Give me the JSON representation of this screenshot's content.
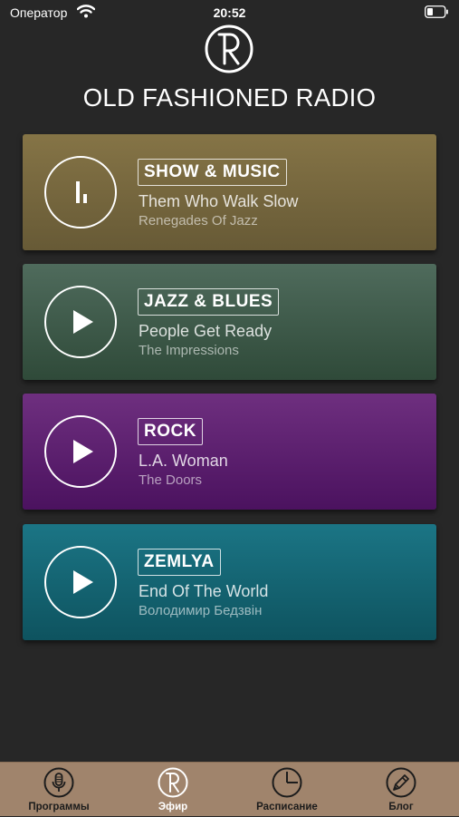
{
  "status_bar": {
    "carrier": "Оператор",
    "time": "20:52"
  },
  "header": {
    "title": "OLD FASHIONED RADIO"
  },
  "stations": [
    {
      "genre": "SHOW & MUSIC",
      "song": "Them Who Walk Slow",
      "artist": "Renegades Of Jazz",
      "state": "playing",
      "icon": "equalizer-icon"
    },
    {
      "genre": "JAZZ & BLUES",
      "song": "People Get Ready",
      "artist": "The Impressions",
      "state": "stopped",
      "icon": "play-icon"
    },
    {
      "genre": "ROCK",
      "song": "L.A. Woman",
      "artist": "The Doors",
      "state": "stopped",
      "icon": "play-icon"
    },
    {
      "genre": "ZEMLYA",
      "song": "End Of The World",
      "artist": "Володимир Бедзвін",
      "state": "stopped",
      "icon": "play-icon"
    }
  ],
  "tabbar": {
    "tabs": [
      {
        "label": "Программы",
        "icon": "microphone-icon",
        "active": false
      },
      {
        "label": "Эфир",
        "icon": "radio-logo-icon",
        "active": true
      },
      {
        "label": "Расписание",
        "icon": "clock-icon",
        "active": false
      },
      {
        "label": "Блог",
        "icon": "pen-icon",
        "active": false
      }
    ]
  },
  "colors": {
    "background": "#272727",
    "tabbar": "#a0846c",
    "show_music": "#857446",
    "jazz_blues": "#4f6b5c",
    "rock": "#6e2f7f",
    "zemlya": "#1b7585"
  }
}
